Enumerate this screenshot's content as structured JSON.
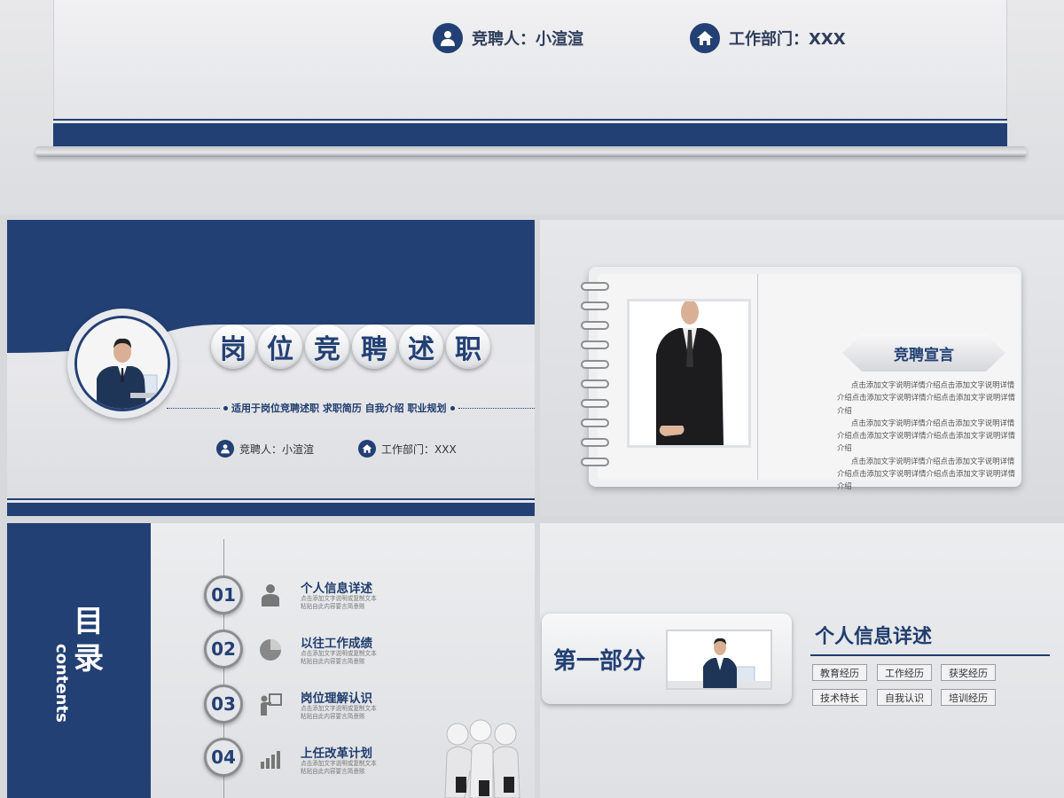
{
  "top_slide": {
    "candidate_label": "竞聘人：小渲渲",
    "department_label": "工作部门：XXX",
    "icons": [
      "person-icon",
      "home-icon"
    ],
    "colors": {
      "navy": "#234074"
    }
  },
  "cover_slide": {
    "title_chars": [
      "岗",
      "位",
      "竞",
      "聘",
      "述",
      "职"
    ],
    "subtitle": "适用于岗位竞聘述职  求职简历  自我介绍  职业规划",
    "candidate_label": "竞聘人：小渲渲",
    "department_label": "工作部门：XXX"
  },
  "notebook_slide": {
    "heading": "竞聘宣言",
    "paragraphs": [
      "点击添加文字说明详情介绍点击添加文字说明详情介绍点击添加文字说明详情介绍点击添加文字说明详情介绍",
      "点击添加文字说明详情介绍点击添加文字说明详情介绍点击添加文字说明详情介绍点击添加文字说明详情介绍",
      "点击添加文字说明详情介绍点击添加文字说明详情介绍点击添加文字说明详情介绍点击添加文字说明详情介绍"
    ]
  },
  "contents_slide": {
    "title": "目录",
    "title_en": "contents",
    "items": [
      {
        "num": "01",
        "title": "个人信息详述",
        "desc": "点击添加文字说明或复制文本粘贴自此内容要言简意赅",
        "icon": "person-icon"
      },
      {
        "num": "02",
        "title": "以往工作成绩",
        "desc": "点击添加文字说明或复制文本粘贴自此内容要言简意赅",
        "icon": "pie-icon"
      },
      {
        "num": "03",
        "title": "岗位理解认识",
        "desc": "点击添加文字说明或复制文本粘贴自此内容要言简意赅",
        "icon": "presenter-icon"
      },
      {
        "num": "04",
        "title": "上任改革计划",
        "desc": "点击添加文字说明或复制文本粘贴自此内容要言简意赅",
        "icon": "bar-chart-icon"
      }
    ]
  },
  "section_slide": {
    "part_label": "第一部分",
    "title": "个人信息详述",
    "tags": [
      "教育经历",
      "工作经历",
      "获奖经历",
      "技术特长",
      "自我认识",
      "培训经历"
    ]
  }
}
